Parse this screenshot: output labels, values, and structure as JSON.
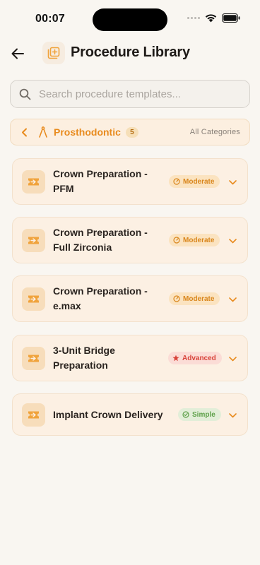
{
  "status_bar": {
    "time": "00:07"
  },
  "header": {
    "title": "Procedure Library",
    "back_icon": "arrow-left-icon",
    "title_icon": "library-add-icon"
  },
  "search": {
    "placeholder": "Search procedure templates...",
    "value": ""
  },
  "category": {
    "name": "Prosthodontic",
    "count": "5",
    "all_label": "All Categories"
  },
  "procedures": [
    {
      "title": "Crown Preparation - PFM",
      "badge": "Moderate",
      "level": "moderate"
    },
    {
      "title": "Crown Preparation - Full Zirconia",
      "badge": "Moderate",
      "level": "moderate"
    },
    {
      "title": "Crown Preparation - e.max",
      "badge": "Moderate",
      "level": "moderate"
    },
    {
      "title": "3-Unit Bridge Preparation",
      "badge": "Advanced",
      "level": "advanced"
    },
    {
      "title": "Implant Crown Delivery",
      "badge": "Simple",
      "level": "simple"
    }
  ],
  "colors": {
    "accent": "#e88b1e",
    "background": "#f9f6f1",
    "moderate": "#d9861c",
    "advanced": "#d8433a",
    "simple": "#5ea14a"
  }
}
